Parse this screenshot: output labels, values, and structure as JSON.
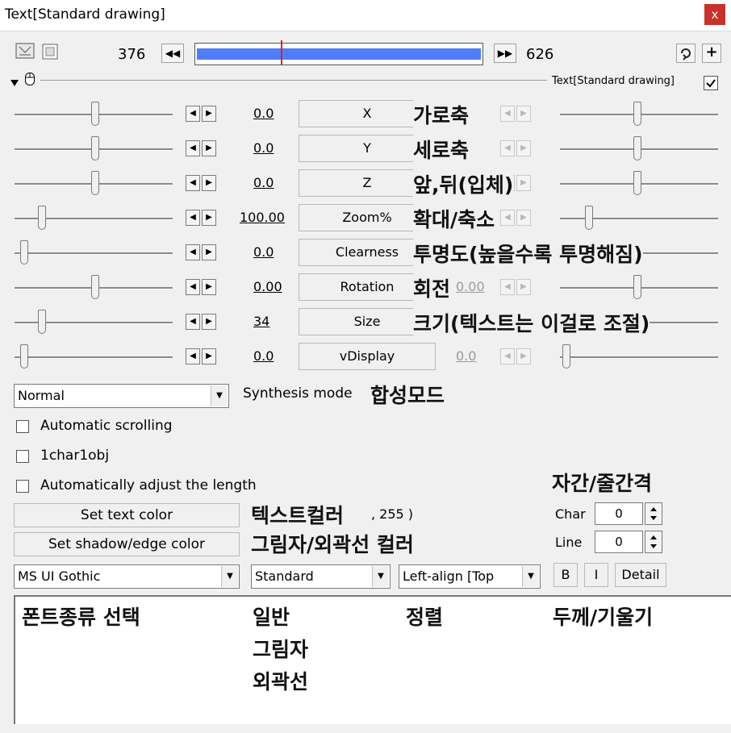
{
  "window": {
    "title": "Text[Standard drawing]",
    "close_label": "x"
  },
  "timeline": {
    "start": "376",
    "end": "626",
    "prev_icon": "◀◀",
    "next_icon": "▶▶",
    "add_icon": "+"
  },
  "header": {
    "object_label": "Text[Standard drawing]"
  },
  "rows": [
    {
      "left_value": "0.0",
      "button": "X",
      "annotation": "가로축",
      "right_value": ""
    },
    {
      "left_value": "0.0",
      "button": "Y",
      "annotation": "세로축",
      "right_value": ""
    },
    {
      "left_value": "0.0",
      "button": "Z",
      "annotation": "앞,뒤(입체)",
      "right_value": ""
    },
    {
      "left_value": "100.00",
      "button": "Zoom%",
      "annotation": "확대/축소",
      "right_value": ""
    },
    {
      "left_value": "0.0",
      "button": "Clearness",
      "annotation": "투명도(높을수록 투명해짐)",
      "right_value": ""
    },
    {
      "left_value": "0.00",
      "button": "Rotation",
      "annotation": "회전",
      "right_value": "0.00"
    },
    {
      "left_value": "34",
      "button": "Size",
      "annotation": "크기(텍스트는 이걸로 조절)",
      "right_value": ""
    },
    {
      "left_value": "0.0",
      "button": "vDisplay",
      "annotation": "",
      "right_value": "0.0"
    }
  ],
  "synthesis": {
    "value": "Normal",
    "label": "Synthesis mode",
    "annotation": "합성모드"
  },
  "checks": [
    {
      "label": "Automatic scrolling"
    },
    {
      "label": "1char1obj"
    },
    {
      "label": "Automatically adjust the length"
    }
  ],
  "colors": {
    "text_button": "Set text color",
    "text_annotation": "텍스트컬러",
    "text_value": ", 255 )",
    "shadow_button": "Set shadow/edge color",
    "shadow_annotation": "그림자/외곽선 컬러"
  },
  "spacing": {
    "annotation": "자간/줄간격",
    "char_label": "Char",
    "char_value": "0",
    "line_label": "Line",
    "line_value": "0"
  },
  "fonts": {
    "font": "MS UI Gothic",
    "style": "Standard",
    "align": "Left-align [Top",
    "bold_label": "B",
    "italic_label": "I",
    "detail_label": "Detail"
  },
  "notes": {
    "font_type": "폰트종류 선택",
    "style_options": [
      "일반",
      "그림자",
      "외곽선"
    ],
    "align": "정렬",
    "weight": "두께/기울기"
  },
  "accent": {
    "selection_blue": "#4f7df5",
    "cursor_red": "#e02020",
    "close_red": "#c9312b"
  }
}
